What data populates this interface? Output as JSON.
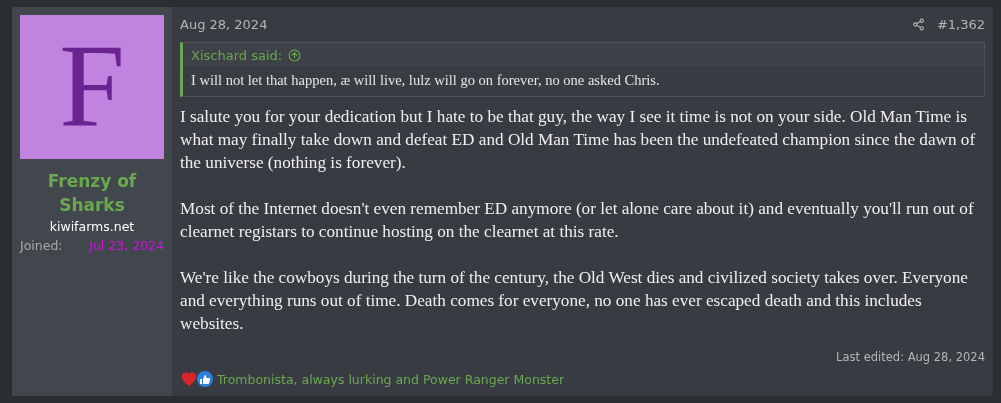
{
  "author": {
    "avatar_letter": "F",
    "name": "Frenzy of Sharks",
    "title": "kiwifarms.net",
    "joined_label": "Joined:",
    "joined_date": "Jul 23, 2024"
  },
  "post": {
    "date": "Aug 28, 2024",
    "number": "#1,362",
    "quote": {
      "author": "Xischard said:",
      "text": "I will not let that happen, æ will live, lulz will go on forever, no one asked Chris."
    },
    "paragraphs": [
      "I salute you for your dedication but I hate to be that guy, the way I see it time is not on your side. Old Man Time is what may finally take down and defeat ED and Old Man Time has been the undefeated champion since the dawn of the universe (nothing is forever).",
      "Most of the Internet doesn't even remember ED anymore (or let alone care about it) and eventually you'll run out of clearnet registars to continue hosting on the clearnet at this rate.",
      "We're like the cowboys during the turn of the century, the Old West dies and civilized society takes over. Everyone and everything runs out of time. Death comes for everyone, no one has ever escaped death and this includes websites."
    ],
    "last_edited": "Last edited: Aug 28, 2024",
    "reactions": "Trombonista, always lurking and Power Ranger Monster"
  }
}
